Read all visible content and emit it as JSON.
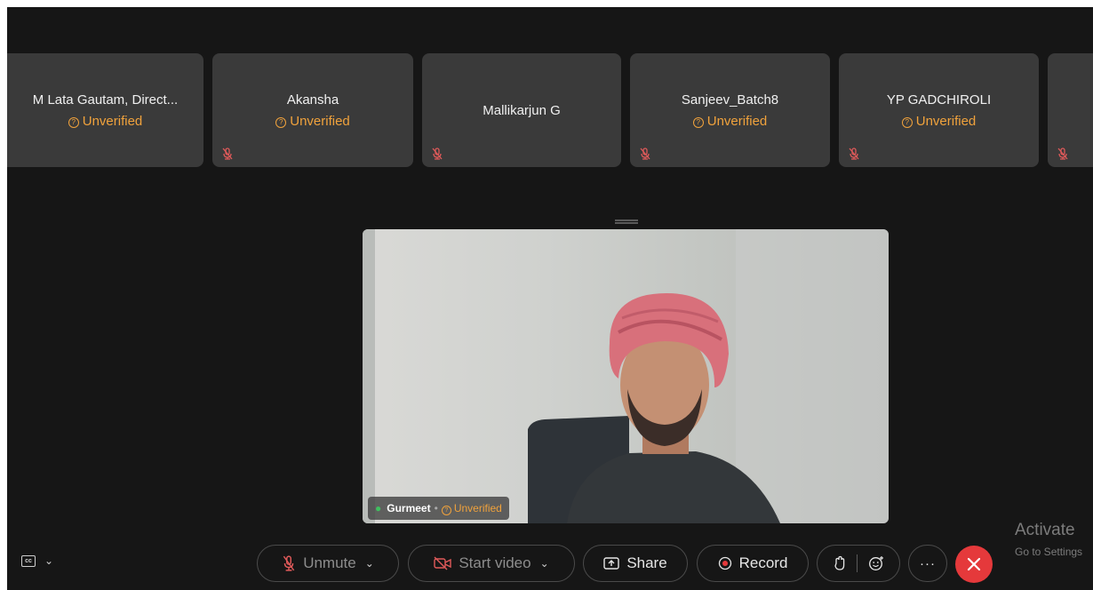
{
  "participants": [
    {
      "name": "M Lata Gautam, Direct...",
      "status": "Unverified",
      "muted": true
    },
    {
      "name": "Akansha",
      "status": "Unverified",
      "muted": true
    },
    {
      "name": "Mallikarjun G",
      "status": "",
      "muted": true
    },
    {
      "name": "Sanjeev_Batch8",
      "status": "Unverified",
      "muted": true
    },
    {
      "name": "YP GADCHIROLI",
      "status": "Unverified",
      "muted": true
    }
  ],
  "active_speaker": {
    "name": "Gurmeet",
    "status": "Unverified"
  },
  "controls": {
    "unmute_label": "Unmute",
    "start_video_label": "Start video",
    "share_label": "Share",
    "record_label": "Record",
    "more_label": "···"
  },
  "watermark": {
    "line1": "Activate",
    "line2": "Go to Settings"
  },
  "icons": [
    "closed-captions-icon",
    "mic-muted-icon",
    "video-off-icon",
    "share-screen-icon",
    "record-icon",
    "raise-hand-icon",
    "reactions-icon",
    "more-icon",
    "end-call-icon"
  ],
  "colors": {
    "unverified": "#f0a23c",
    "end_call": "#e5393b",
    "muted_mic": "#e05a5a",
    "background": "#161616",
    "tile": "#3a3a3a"
  }
}
